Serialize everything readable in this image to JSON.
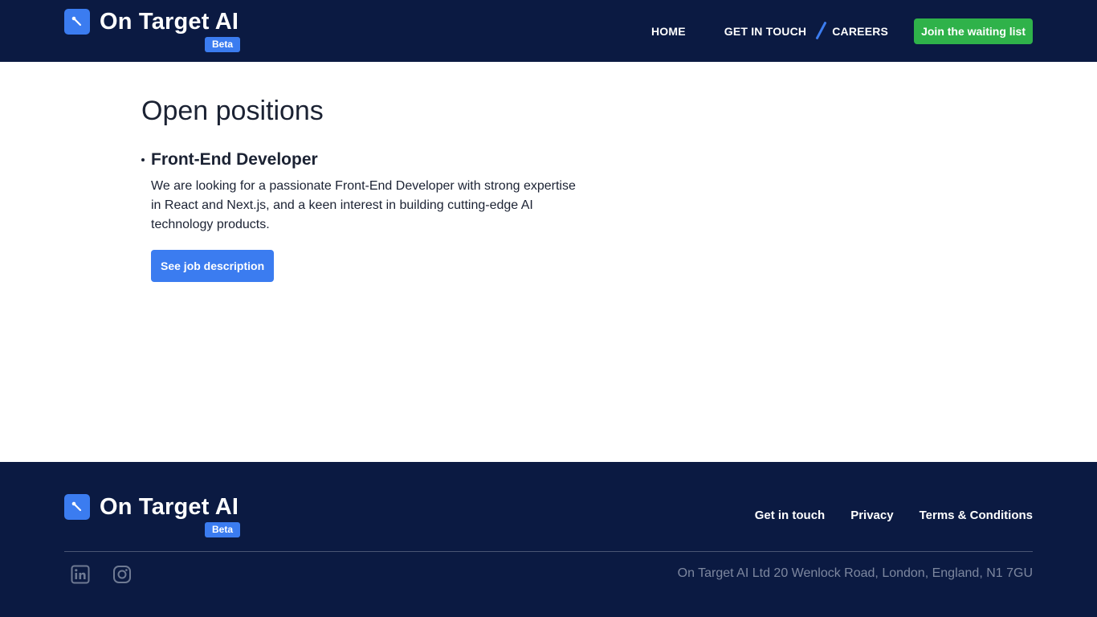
{
  "header": {
    "brand": "On Target AI",
    "badge": "Beta",
    "nav": {
      "home": "HOME",
      "get_in_touch": "GET IN TOUCH",
      "careers": "CAREERS"
    },
    "cta_label": "Join the waiting list"
  },
  "main": {
    "title": "Open positions",
    "jobs": [
      {
        "title": "Front-End Developer",
        "description": "We are looking for a passionate Front-End Developer with strong expertise in React and Next.js, and a keen interest in building cutting-edge AI technology products.",
        "button_label": "See job description"
      }
    ]
  },
  "footer": {
    "brand": "On Target AI",
    "badge": "Beta",
    "links": {
      "get_in_touch": "Get in touch",
      "privacy": "Privacy",
      "terms": "Terms & Conditions"
    },
    "social_icons": [
      "linkedin-icon",
      "instagram-icon"
    ],
    "address": "On Target AI Ltd 20 Wenlock Road, London, England, N1 7GU"
  },
  "colors": {
    "navy": "#0b1a42",
    "accent_blue": "#3b7cf0",
    "cta_green": "#2fb24a",
    "text_dark": "#1b2233",
    "muted_gray": "#7d879f"
  }
}
